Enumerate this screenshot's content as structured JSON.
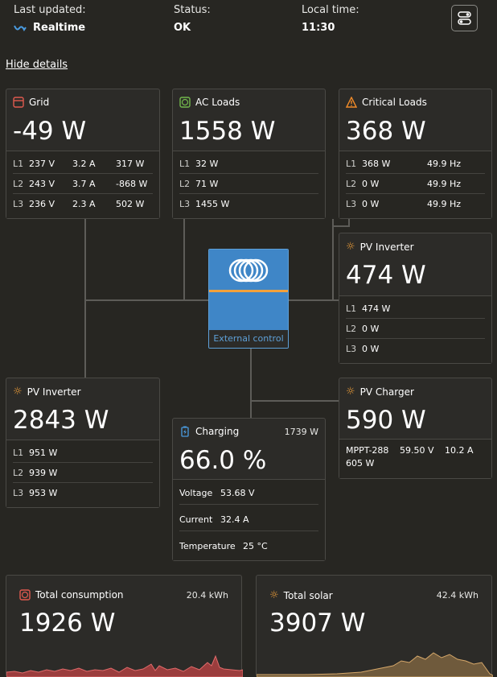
{
  "header": {
    "last_updated_label": "Last updated:",
    "last_updated_value": "Realtime",
    "status_label": "Status:",
    "status_value": "OK",
    "local_time_label": "Local time:",
    "local_time_value": "11:30",
    "hide_details": "Hide details"
  },
  "grid": {
    "title": "Grid",
    "power": "-49 W",
    "rows": [
      {
        "phase": "L1",
        "volt": "237 V",
        "amp": "3.2 A",
        "power": "317 W"
      },
      {
        "phase": "L2",
        "volt": "243 V",
        "amp": "3.7 A",
        "power": "-868 W"
      },
      {
        "phase": "L3",
        "volt": "236 V",
        "amp": "2.3 A",
        "power": "502 W"
      }
    ]
  },
  "ac_loads": {
    "title": "AC Loads",
    "power": "1558 W",
    "rows": [
      {
        "phase": "L1",
        "power": "32 W"
      },
      {
        "phase": "L2",
        "power": "71 W"
      },
      {
        "phase": "L3",
        "power": "1455 W"
      }
    ]
  },
  "critical_loads": {
    "title": "Critical Loads",
    "power": "368 W",
    "rows": [
      {
        "phase": "L1",
        "power": "368 W",
        "freq": "49.9 Hz"
      },
      {
        "phase": "L2",
        "power": "0 W",
        "freq": "49.9 Hz"
      },
      {
        "phase": "L3",
        "power": "0 W",
        "freq": "49.9 Hz"
      }
    ]
  },
  "pv_inverter_right": {
    "title": "PV Inverter",
    "power": "474 W",
    "rows": [
      {
        "phase": "L1",
        "power": "474 W"
      },
      {
        "phase": "L2",
        "power": "0 W"
      },
      {
        "phase": "L3",
        "power": "0 W"
      }
    ]
  },
  "inverter": {
    "label": "External control"
  },
  "pv_inverter_left": {
    "title": "PV Inverter",
    "power": "2843 W",
    "rows": [
      {
        "phase": "L1",
        "power": "951 W"
      },
      {
        "phase": "L2",
        "power": "939 W"
      },
      {
        "phase": "L3",
        "power": "953 W"
      }
    ]
  },
  "battery": {
    "title": "Charging",
    "power_small": "1739 W",
    "soc": "66.0 %",
    "voltage_label": "Voltage",
    "voltage": "53.68 V",
    "current_label": "Current",
    "current": "32.4 A",
    "temperature_label": "Temperature",
    "temperature": "25 °C"
  },
  "pv_charger": {
    "title": "PV Charger",
    "power": "590 W",
    "mppt_name": "MPPT-288",
    "mppt_voltage": "59.50 V",
    "mppt_current": "10.2 A",
    "mppt_power": "605 W"
  },
  "total_consumption": {
    "title": "Total consumption",
    "energy": "20.4 kWh",
    "power": "1926 W"
  },
  "total_solar": {
    "title": "Total solar",
    "energy": "42.4 kWh",
    "power": "3907 W"
  },
  "colors": {
    "background": "#272622",
    "card": "#2c2b28",
    "border": "#4a4945",
    "grid_icon": "#e05a4f",
    "ac_icon": "#72b84c",
    "warning_icon": "#f08a28",
    "solar_icon": "#f3a13a",
    "inverter_blue": "#3f86c7",
    "inverter_stripe": "#f3a13a",
    "consumption_spark": "#e06b6b",
    "solar_spark": "#d6a86a"
  }
}
